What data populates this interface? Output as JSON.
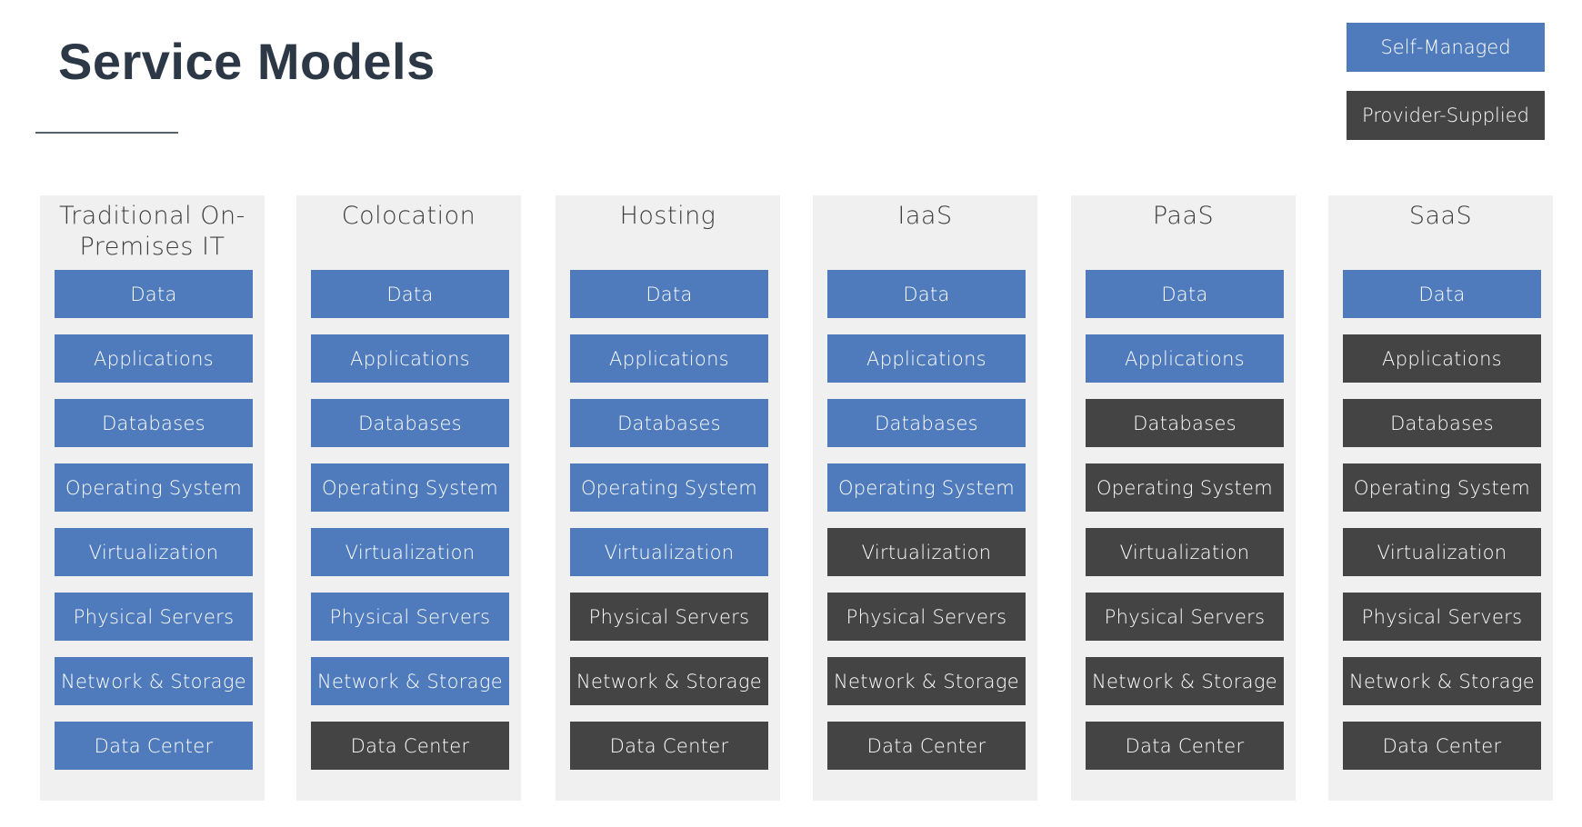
{
  "page": {
    "title": "Service Models"
  },
  "colors": {
    "self_managed": "#4f7bbd",
    "provider_supplied": "#444444",
    "column_bg": "#f0f0f0"
  },
  "legend": [
    {
      "label": "Self-Managed",
      "status": "self_managed"
    },
    {
      "label": "Provider-Supplied",
      "status": "provider_supplied"
    }
  ],
  "columns": [
    {
      "title": "Traditional On-Premises IT",
      "layers": [
        {
          "label": "Data",
          "status": "self_managed"
        },
        {
          "label": "Applications",
          "status": "self_managed"
        },
        {
          "label": "Databases",
          "status": "self_managed"
        },
        {
          "label": "Operating System",
          "status": "self_managed"
        },
        {
          "label": "Virtualization",
          "status": "self_managed"
        },
        {
          "label": "Physical Servers",
          "status": "self_managed"
        },
        {
          "label": "Network & Storage",
          "status": "self_managed"
        },
        {
          "label": "Data Center",
          "status": "self_managed"
        }
      ]
    },
    {
      "title": "Colocation",
      "layers": [
        {
          "label": "Data",
          "status": "self_managed"
        },
        {
          "label": "Applications",
          "status": "self_managed"
        },
        {
          "label": "Databases",
          "status": "self_managed"
        },
        {
          "label": "Operating System",
          "status": "self_managed"
        },
        {
          "label": "Virtualization",
          "status": "self_managed"
        },
        {
          "label": "Physical Servers",
          "status": "self_managed"
        },
        {
          "label": "Network & Storage",
          "status": "self_managed"
        },
        {
          "label": "Data Center",
          "status": "provider_supplied"
        }
      ]
    },
    {
      "title": "Hosting",
      "layers": [
        {
          "label": "Data",
          "status": "self_managed"
        },
        {
          "label": "Applications",
          "status": "self_managed"
        },
        {
          "label": "Databases",
          "status": "self_managed"
        },
        {
          "label": "Operating System",
          "status": "self_managed"
        },
        {
          "label": "Virtualization",
          "status": "self_managed"
        },
        {
          "label": "Physical Servers",
          "status": "provider_supplied"
        },
        {
          "label": "Network & Storage",
          "status": "provider_supplied"
        },
        {
          "label": "Data Center",
          "status": "provider_supplied"
        }
      ]
    },
    {
      "title": "IaaS",
      "layers": [
        {
          "label": "Data",
          "status": "self_managed"
        },
        {
          "label": "Applications",
          "status": "self_managed"
        },
        {
          "label": "Databases",
          "status": "self_managed"
        },
        {
          "label": "Operating System",
          "status": "self_managed"
        },
        {
          "label": "Virtualization",
          "status": "provider_supplied"
        },
        {
          "label": "Physical Servers",
          "status": "provider_supplied"
        },
        {
          "label": "Network & Storage",
          "status": "provider_supplied"
        },
        {
          "label": "Data Center",
          "status": "provider_supplied"
        }
      ]
    },
    {
      "title": "PaaS",
      "layers": [
        {
          "label": "Data",
          "status": "self_managed"
        },
        {
          "label": "Applications",
          "status": "self_managed"
        },
        {
          "label": "Databases",
          "status": "provider_supplied"
        },
        {
          "label": "Operating System",
          "status": "provider_supplied"
        },
        {
          "label": "Virtualization",
          "status": "provider_supplied"
        },
        {
          "label": "Physical Servers",
          "status": "provider_supplied"
        },
        {
          "label": "Network & Storage",
          "status": "provider_supplied"
        },
        {
          "label": "Data Center",
          "status": "provider_supplied"
        }
      ]
    },
    {
      "title": "SaaS",
      "layers": [
        {
          "label": "Data",
          "status": "self_managed"
        },
        {
          "label": "Applications",
          "status": "provider_supplied"
        },
        {
          "label": "Databases",
          "status": "provider_supplied"
        },
        {
          "label": "Operating System",
          "status": "provider_supplied"
        },
        {
          "label": "Virtualization",
          "status": "provider_supplied"
        },
        {
          "label": "Physical Servers",
          "status": "provider_supplied"
        },
        {
          "label": "Network & Storage",
          "status": "provider_supplied"
        },
        {
          "label": "Data Center",
          "status": "provider_supplied"
        }
      ]
    }
  ]
}
